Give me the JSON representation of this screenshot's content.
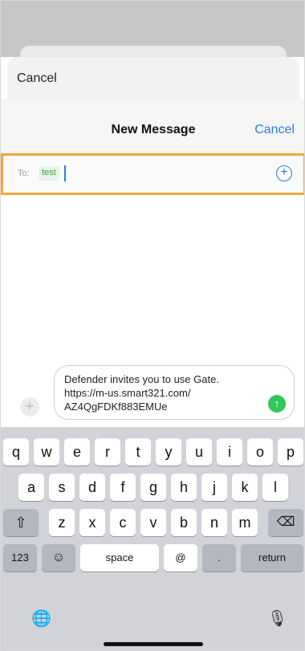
{
  "outer": {
    "cancel_label": "Cancel"
  },
  "compose": {
    "title": "New Message",
    "cancel_label": "Cancel",
    "to_label": "To:",
    "recipient": "test",
    "add_icon": "plus-circle-icon"
  },
  "message": {
    "text": "Defender invites you to use Gate.\nhttps://m-us.smart321.com/\nAZ4QgFDKf883EMUe",
    "attach_icon": "plus-icon",
    "send_icon": "arrow-up-icon"
  },
  "keyboard": {
    "row1": [
      "q",
      "w",
      "e",
      "r",
      "t",
      "y",
      "u",
      "i",
      "o",
      "p"
    ],
    "row2": [
      "a",
      "s",
      "d",
      "f",
      "g",
      "h",
      "j",
      "k",
      "l"
    ],
    "row3": [
      "z",
      "x",
      "c",
      "v",
      "b",
      "n",
      "m"
    ],
    "shift_icon": "shift-icon",
    "delete_icon": "delete-icon",
    "numbers_label": "123",
    "emoji_icon": "emoji-icon",
    "space_label": "space",
    "at_label": "@",
    "dot_label": ".",
    "return_label": "return",
    "globe_icon": "globe-icon",
    "mic_icon": "mic-icon"
  },
  "colors": {
    "accent": "#2a7de1",
    "highlight": "#f5a53a",
    "send": "#34c759",
    "chip": "#3aa63f"
  }
}
